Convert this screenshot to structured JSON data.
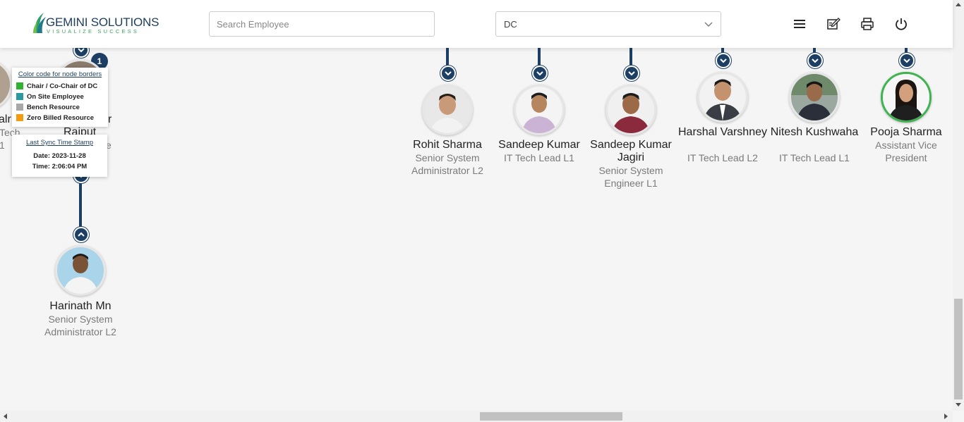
{
  "header": {
    "logo_name": "GEMINI SOLUTIONS",
    "logo_tagline": "VISUALIZE SUCCESS",
    "search_placeholder": "Search Employee",
    "department_selected": "DC",
    "icons": [
      "menu-icon",
      "edit-icon",
      "print-icon",
      "power-icon"
    ]
  },
  "legend": {
    "title": "Color code for node borders",
    "items": [
      {
        "label": "Chair / Co-Chair of DC",
        "color": "#2fb22f"
      },
      {
        "label": "On Site Employee",
        "color": "#2a9aa0"
      },
      {
        "label": "Bench Resource",
        "color": "#a8a8a8"
      },
      {
        "label": "Zero Billed Resource",
        "color": "#f39c12"
      }
    ]
  },
  "sync": {
    "title": "Last Sync Time Stamp",
    "date": "Date: 2023-11-28",
    "time": "Time: 2:06:04 PM"
  },
  "count_badge": "1",
  "partial_text": {
    "a": "alr",
    "b": "r",
    "c": "Rajput",
    "d": "Tech",
    "e": "e",
    "f": "1"
  },
  "employees": [
    {
      "name": "Rohit Sharma",
      "title": "Senior System Administrator L2",
      "border": "default"
    },
    {
      "name": "Sandeep Kumar",
      "title": "IT Tech Lead L1",
      "border": "default"
    },
    {
      "name": "Sandeep Kumar Jagiri",
      "title": "Senior System Engineer L1",
      "border": "default"
    },
    {
      "name": "Harshal Varshney",
      "title": "IT Tech Lead L2",
      "border": "default"
    },
    {
      "name": "Nitesh Kushwaha",
      "title": "IT Tech Lead L1",
      "border": "default"
    },
    {
      "name": "Pooja Sharma",
      "title": "Assistant Vice President",
      "border": "chair"
    },
    {
      "name": "Harinath Mn",
      "title": "Senior System Administrator L2",
      "border": "default"
    }
  ],
  "colors": {
    "connector": "#1c3f63",
    "chair_border": "#3fb34f"
  }
}
